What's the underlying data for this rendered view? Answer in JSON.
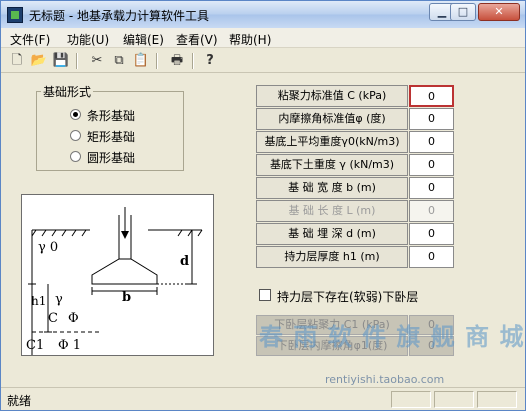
{
  "window": {
    "title": "无标题 - 地基承载力计算软件工具",
    "minimize_icon": "minimize-icon",
    "maximize_icon": "maximize-icon",
    "close_icon": "close-icon"
  },
  "menu": [
    {
      "label": "文件(F)"
    },
    {
      "label": "功能(U)"
    },
    {
      "label": "编辑(E)"
    },
    {
      "label": "查看(V)"
    },
    {
      "label": "帮助(H)"
    }
  ],
  "toolbar": [
    {
      "name": "new-file-icon",
      "glyph": "🗋"
    },
    {
      "name": "open-folder-icon",
      "glyph": "📂"
    },
    {
      "name": "save-icon",
      "glyph": "💾"
    },
    {
      "name": "cut-icon",
      "glyph": "✂"
    },
    {
      "name": "copy-icon",
      "glyph": "⧉"
    },
    {
      "name": "paste-icon",
      "glyph": "📋"
    },
    {
      "name": "print-icon",
      "glyph": "🖶"
    },
    {
      "name": "help-icon",
      "glyph": "?"
    }
  ],
  "foundation": {
    "legend": "基础形式",
    "options": [
      {
        "label": "条形基础",
        "checked": true
      },
      {
        "label": "矩形基础",
        "checked": false
      },
      {
        "label": "圆形基础",
        "checked": false
      }
    ]
  },
  "diagram": {
    "gamma0": "γ 0",
    "d": "d",
    "h1": "h1",
    "gamma": "γ",
    "b": "b",
    "C": "C",
    "phi": "Φ",
    "C1": "C1",
    "phi1": "Φ 1"
  },
  "params": [
    {
      "label": "粘聚力标准值 C  (kPa)",
      "value": "0",
      "enabled": true,
      "active": true
    },
    {
      "label": "内摩擦角标准值φ (度)",
      "value": "0",
      "enabled": true
    },
    {
      "label": "基底上平均重度γ0(kN/m3)",
      "value": "0",
      "enabled": true
    },
    {
      "label": "基底下土重度 γ (kN/m3)",
      "value": "0",
      "enabled": true
    },
    {
      "label": "基 础 宽 度 b   (m)",
      "value": "0",
      "enabled": true
    },
    {
      "label": "基 础 长 度 L   (m)",
      "value": "0",
      "enabled": false
    },
    {
      "label": "基 础 埋 深 d   (m)",
      "value": "0",
      "enabled": true
    },
    {
      "label": "持力层厚度 h1   (m)",
      "value": "0",
      "enabled": true
    }
  ],
  "weak_layer": {
    "checkbox_label": "持力层下存在(软弱)下卧层",
    "checked": false,
    "rows": [
      {
        "label": "下卧层粘聚力 C1 (kPa)",
        "value": "0"
      },
      {
        "label": "下卧层内摩擦角φ1(度)",
        "value": "0"
      }
    ]
  },
  "watermark": {
    "text": "春 雨 软 件 旗 舰 商 城",
    "url": "rentiyishi.taobao.com"
  },
  "status": {
    "text": "就绪"
  }
}
